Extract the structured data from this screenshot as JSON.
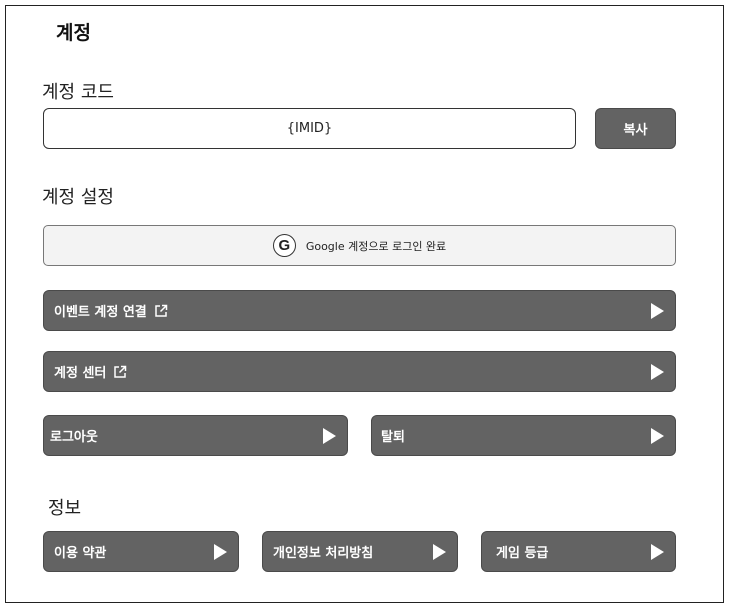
{
  "header": {
    "title": "계정"
  },
  "account_code": {
    "section_label": "계정 코드",
    "value": "{IMID}",
    "copy_label": "복사"
  },
  "account_settings": {
    "section_label": "계정 설정",
    "google_login_label": "Google 계정으로 로그인 완료",
    "google_icon_glyph": "G",
    "event_link_label": "이벤트 계정 연결",
    "account_center_label": "계정 센터",
    "logout_label": "로그아웃",
    "withdraw_label": "탈퇴"
  },
  "info": {
    "section_label": "정보",
    "terms_label": "이용 약관",
    "privacy_label": "개인정보 처리방침",
    "rating_label": "게임 등급"
  },
  "icons": {
    "external": "external-link-icon",
    "arrow": "play-arrow-icon",
    "google": "google-icon"
  },
  "colors": {
    "button_dark": "#636363",
    "google_button_bg": "#f3f3f3",
    "text": "#111111"
  }
}
